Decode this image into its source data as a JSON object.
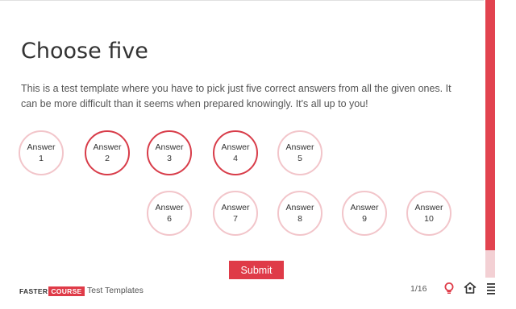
{
  "quiz": {
    "title": "Choose five",
    "description": "This is a test template where you have to pick just five correct answers from all the given ones. It can be more difficult than it seems when prepared knowingly. It's all up to you!",
    "answers": [
      {
        "word": "Answer",
        "num": "1",
        "selected": false
      },
      {
        "word": "Answer",
        "num": "2",
        "selected": true
      },
      {
        "word": "Answer",
        "num": "3",
        "selected": true
      },
      {
        "word": "Answer",
        "num": "4",
        "selected": true
      },
      {
        "word": "Answer",
        "num": "5",
        "selected": false
      },
      {
        "word": "Answer",
        "num": "6",
        "selected": false
      },
      {
        "word": "Answer",
        "num": "7",
        "selected": false
      },
      {
        "word": "Answer",
        "num": "8",
        "selected": false
      },
      {
        "word": "Answer",
        "num": "9",
        "selected": false
      },
      {
        "word": "Answer",
        "num": "10",
        "selected": false
      }
    ],
    "submit_label": "Submit"
  },
  "footer": {
    "logo_part1": "FASTER",
    "logo_part2": "COURSE",
    "course_title": "Test Templates",
    "pager": "1/16",
    "icons": [
      "lightbulb-icon",
      "home-icon",
      "menu-icon"
    ]
  },
  "progress": {
    "fraction": 0.9
  },
  "colors": {
    "accent": "#df3b48",
    "unselected_border": "#f2c5ca",
    "progress_track": "#f3d0d4"
  }
}
